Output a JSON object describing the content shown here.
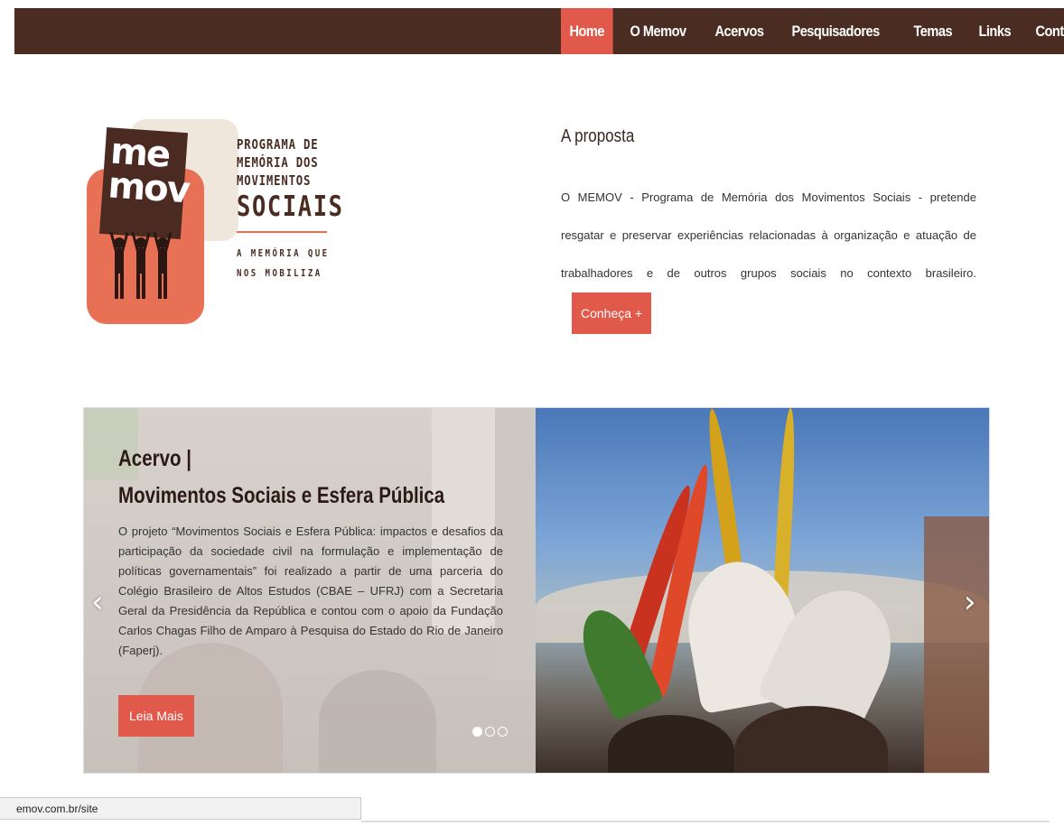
{
  "nav": {
    "items": [
      {
        "label": "Home",
        "active": true
      },
      {
        "label": "O Memov",
        "active": false
      },
      {
        "label": "Acervos",
        "active": false
      },
      {
        "label": "Pesquisadores",
        "active": false
      },
      {
        "label": "Temas",
        "active": false
      },
      {
        "label": "Links",
        "active": false
      },
      {
        "label": "Contato",
        "active": false
      }
    ]
  },
  "logo": {
    "mark_line1": "me",
    "mark_line2": "mov",
    "line1": "PROGRAMA DE",
    "line2": "MEMÓRIA DOS",
    "line3": "MOVIMENTOS",
    "line4": "SOCIAIS",
    "tagline1": "A MEMÓRIA QUE",
    "tagline2": "NOS MOBILIZA"
  },
  "proposal": {
    "heading": "A proposta",
    "text": "O MEMOV - Programa de Memória dos Movimentos Sociais - pretende resgatar e preservar experiências relacionadas à organização e atuação de trabalhadores e de outros grupos sociais no contexto brasileiro.",
    "button_label": "Conheça +"
  },
  "slider": {
    "kicker": "Acervo |",
    "title": "Movimentos Sociais e Esfera Pública",
    "body": "O projeto “Movimentos Sociais e Esfera Pública: impactos e desafios da participação da sociedade civil na formulação e implementação de políticas governamentais” foi realizado a partir de uma parceria do Colégio Brasileiro de Altos Estudos (CBAE – UFRJ) com a Secretaria Geral da Presidência da República e contou com o apoio da Fundação Carlos Chagas Filho de Amparo à Pesquisa do Estado do Rio de Janeiro (Faperj).",
    "button_label": "Leia Mais",
    "prev_icon": "‹",
    "next_icon": "›",
    "slide_count": 3,
    "active_slide": 1
  },
  "status_bar": {
    "url": "emov.com.br/site"
  },
  "colors": {
    "nav_bg": "#4a2c22",
    "accent": "#e0594a"
  }
}
